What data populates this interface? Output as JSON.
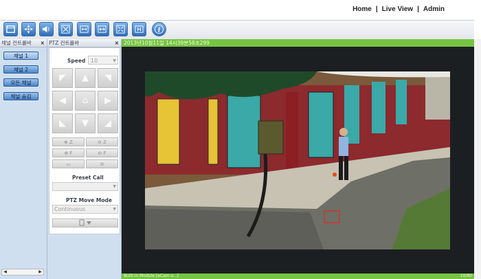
{
  "topnav": {
    "home": "Home",
    "live_view": "Live View",
    "admin": "Admin",
    "separator": "|"
  },
  "toolbar": {
    "buttons": [
      "layout-icon",
      "ptz-icon",
      "audio-icon",
      "fullscreen-icon",
      "fit-icon",
      "stretch-icon",
      "expand-icon",
      "capture-icon",
      "info-icon"
    ]
  },
  "channel_panel": {
    "title": "채널 컨트롤바",
    "close": "×",
    "buttons": [
      {
        "label": "채널 1",
        "active": true
      },
      {
        "label": "채널 2",
        "active": false
      },
      {
        "label": "모든 채널",
        "active": false
      },
      {
        "label": "채널 숨김",
        "active": false
      }
    ],
    "scroll_left": "◀",
    "scroll_right": "▶"
  },
  "ptz_panel": {
    "title": "PTZ 컨트롤바",
    "close": "×",
    "speed_label": "Speed",
    "speed_value": "10",
    "preset_label": "Preset Call",
    "preset_value": "",
    "move_mode_label": "PTZ Move Mode",
    "move_mode_value": "Continuous",
    "arrows": [
      "◤",
      "▲",
      "◥",
      "◀",
      "⌂",
      "▶",
      "◣",
      "▼",
      "◢"
    ],
    "zoom_buttons": [
      "⊕ Z",
      "⊖ Z",
      "⊕ F",
      "⊖ F",
      "▭",
      "⊘"
    ]
  },
  "video": {
    "timestamp": "2013년10월11일 14시39분58초299",
    "footer_left": "Built-in Module [eCam-v...]",
    "footer_right": "10/60"
  }
}
